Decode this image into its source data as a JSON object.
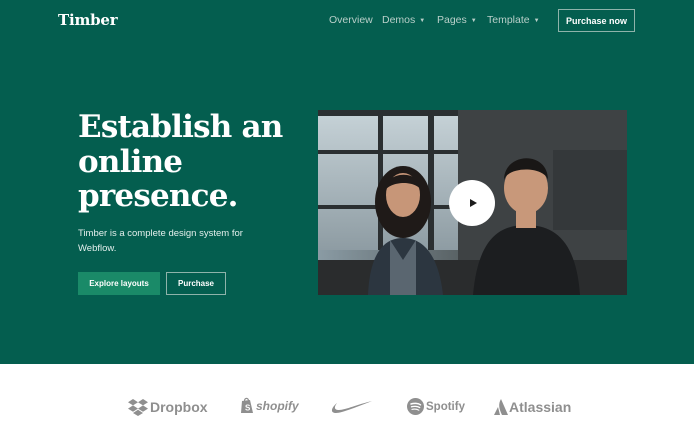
{
  "brand": {
    "name": "Timber"
  },
  "nav": {
    "links": [
      {
        "label": "Overview",
        "has_dropdown": false
      },
      {
        "label": "Demos",
        "has_dropdown": true
      },
      {
        "label": "Pages",
        "has_dropdown": true
      },
      {
        "label": "Template",
        "has_dropdown": true
      }
    ],
    "cta_label": "Purchase now"
  },
  "hero": {
    "headline_lines": [
      "Establish an",
      "online",
      "presence."
    ],
    "subtext": "Timber is a complete design system for Webflow.",
    "primary_button": "Explore layouts",
    "secondary_button": "Purchase",
    "video": {
      "play_icon": "play-icon"
    }
  },
  "logos": [
    {
      "name": "Dropbox",
      "icon": "dropbox-icon"
    },
    {
      "name": "shopify",
      "icon": "shopify-icon"
    },
    {
      "name": "",
      "icon": "nike-swoosh-icon"
    },
    {
      "name": "Spotify",
      "icon": "spotify-icon"
    },
    {
      "name": "Atlassian",
      "icon": "atlassian-icon"
    }
  ],
  "colors": {
    "hero_background": "#045e4f",
    "primary_button": "#1a8a68",
    "logo_gray": "#8f8f8f"
  }
}
